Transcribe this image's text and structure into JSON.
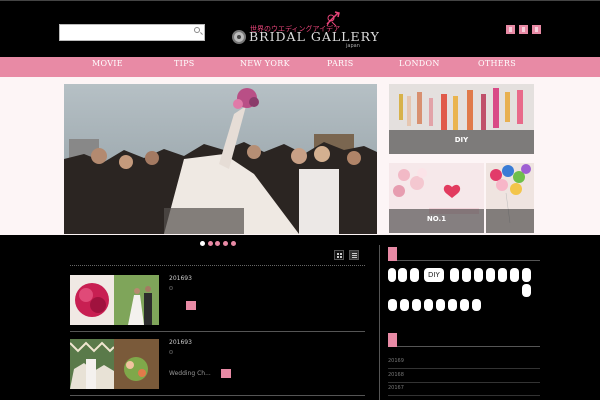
{
  "header": {
    "search_placeholder": "",
    "logo_tagline": "世界のウエディングアイデア",
    "logo_name": "BRIDAL GALLERY",
    "logo_sub": "japan",
    "social": [
      "facebook-icon",
      "twitter-icon",
      "instagram-icon"
    ]
  },
  "nav": {
    "items": [
      {
        "label": "MOVIE"
      },
      {
        "label": "TIPS"
      },
      {
        "label": "NEW YORK"
      },
      {
        "label": "PARIS"
      },
      {
        "label": "LONDON"
      },
      {
        "label": "OTHERS"
      }
    ]
  },
  "featured": {
    "side": [
      {
        "label": "DIY"
      },
      {
        "label": "NO.1"
      },
      {
        "label": ""
      }
    ]
  },
  "slider": {
    "dot_count": 5,
    "active_dot": 0
  },
  "posts": [
    {
      "date": "201693",
      "title": ""
    },
    {
      "date": "201693",
      "title": "Wedding Ch..."
    }
  ],
  "sidebar": {
    "tags_row1_highlight": "DIY",
    "archive": [
      "20169",
      "20168",
      "20167"
    ]
  },
  "colors": {
    "accent": "#e88aa5",
    "background": "#000000",
    "featured_bg": "#fdf5f6"
  }
}
